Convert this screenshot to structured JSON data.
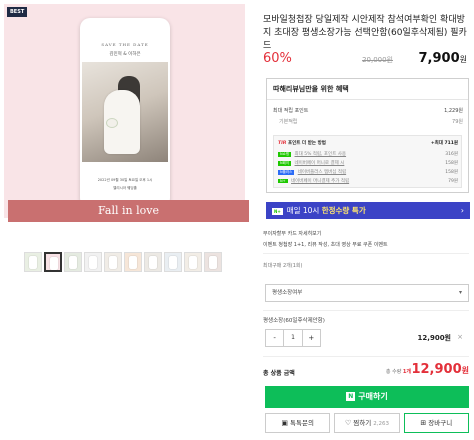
{
  "gallery": {
    "badge": "BEST",
    "phone_header": "SAVE THE DATE",
    "phone_names": "김민혁 & 이하은",
    "phone_date": "2022년 09월 30일 토요일 오후 1시",
    "phone_venue": "엘리시아 웨딩홀",
    "banner_text": "Fall in love",
    "thumbnail_count": 10
  },
  "product": {
    "title": "모바일청첩장 당일제작 시안제작 참석여부확인 확대방지 초대장 평생소장가능 선택안함(60일후삭제됨) 필카드",
    "discount": "60%",
    "original_price": "20,000원",
    "sale_price": "7,900",
    "sale_unit": "원"
  },
  "benefits": {
    "title": "따해리뷰님만을 위한 혜택",
    "max_points_label": "최대 적립 포인트",
    "max_points_value": "1,229원",
    "basic_label": "기본적립",
    "basic_value": "79원",
    "tip_label": "TIP.",
    "tip_text": "포인트 더 받는 방법",
    "tip_value": "+최대 711원",
    "rows": [
      {
        "tag": "N쇼핑",
        "text": "최대 5% 적립, 포인트 사용",
        "value": "316원"
      },
      {
        "tag": "N페이",
        "text": "네이버페이 머니로 결제 시",
        "value": "158원"
      },
      {
        "tag": "N플러스",
        "text": "네이버플러스 멤버십 적립",
        "value": "158원"
      },
      {
        "tag": "N+",
        "text": "네이버페이 머니결제 추가 적립",
        "value": "79원"
      }
    ]
  },
  "promo": {
    "badge": "N+",
    "text_before": "매일 10시 ",
    "text_highlight": "한정수량 특가",
    "chevron": "›"
  },
  "info": {
    "payment": "무이자할부  카드 자세히보기",
    "event": "이벤트  청첩장 1+1, 리뷰 작성, 초대 영상 무료 쿠폰 이벤트",
    "max_purchase": "최대구매 2개(1회)"
  },
  "option": {
    "select_value": "평생소장여부",
    "option_label": "평생소장(60일후삭제안함)",
    "minus": "-",
    "qty": "1",
    "plus": "+",
    "price": "12,900원",
    "delete": "×"
  },
  "total": {
    "label": "총 상품 금액",
    "qty_label": "총 수량 ",
    "qty_value": "1개",
    "price": "12,900",
    "unit": "원"
  },
  "actions": {
    "buy_badge": "N",
    "buy_label": "구매하기",
    "inquiry_label": "톡톡문의",
    "like_label": "찜하기",
    "like_count": "2,263",
    "cart_label": "장바구니"
  },
  "colors": {
    "accent_red": "#e3303a",
    "buy_green": "#0dbe59",
    "promo_blue": "#3b43c6",
    "banner_rose": "#c97070"
  }
}
